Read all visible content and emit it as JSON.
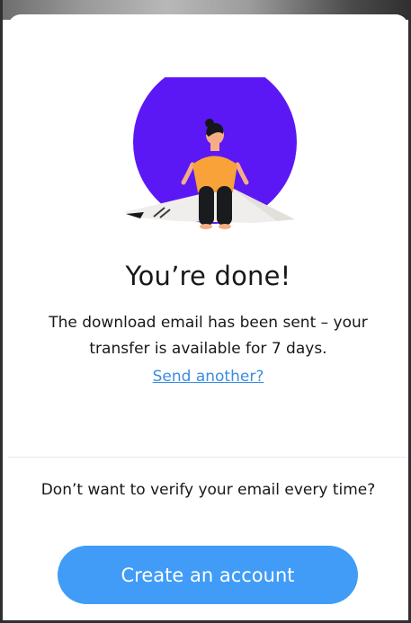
{
  "dialog": {
    "title": "You’re done!",
    "message": "The download email has been sent – your transfer is available for 7 days.",
    "send_another_link": "Send another?"
  },
  "account_prompt": {
    "text": "Don’t want to verify your email every time?",
    "button_label": "Create an account"
  },
  "colors": {
    "accent": "#409cf7",
    "link": "#3a8de0",
    "illustration_circle": "#5b18f5"
  },
  "icons": {
    "illustration": "person-sitting-on-envelope-illustration"
  }
}
